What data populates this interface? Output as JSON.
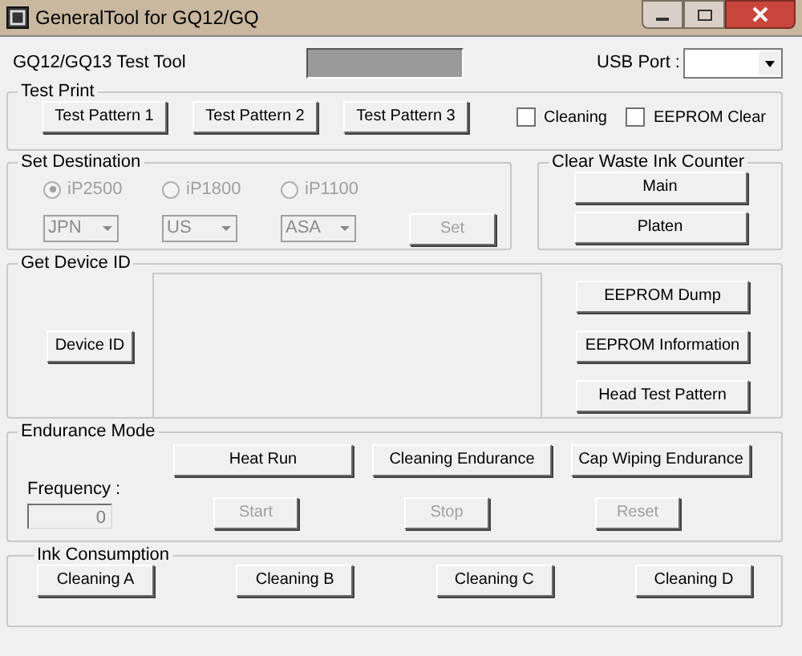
{
  "window": {
    "title": "GeneralTool for GQ12/GQ"
  },
  "header": {
    "title": "GQ12/GQ13 Test Tool",
    "usb_port": {
      "label": "USB Port :"
    }
  },
  "test_print": {
    "title": "Test Print",
    "buttons": [
      "Test Pattern 1",
      "Test Pattern 2",
      "Test Pattern 3"
    ],
    "checkboxes": [
      {
        "label": "Cleaning",
        "checked": false
      },
      {
        "label": "EEPROM Clear",
        "checked": false
      }
    ]
  },
  "set_destination": {
    "title": "Set Destination",
    "disabled": true,
    "models": [
      {
        "label": "iP2500",
        "selected": true
      },
      {
        "label": "iP1800",
        "selected": false
      },
      {
        "label": "iP1100",
        "selected": false
      }
    ],
    "regions": [
      "JPN",
      "US",
      "ASA"
    ],
    "set_button": "Set"
  },
  "clear_waste_ink_counter": {
    "title": "Clear Waste Ink Counter",
    "buttons": [
      "Main",
      "Platen"
    ]
  },
  "get_device_id": {
    "title": "Get Device ID",
    "device_id_button": "Device ID",
    "buttons": [
      "EEPROM Dump",
      "EEPROM Information",
      "Head Test Pattern"
    ]
  },
  "endurance_mode": {
    "title": "Endurance Mode",
    "buttons": [
      "Heat Run",
      "Cleaning Endurance",
      "Cap Wiping Endurance"
    ],
    "frequency": {
      "label": "Frequency :",
      "value": "0",
      "disabled": true
    },
    "controls": [
      {
        "label": "Start",
        "disabled": true
      },
      {
        "label": "Stop",
        "disabled": true
      },
      {
        "label": "Reset",
        "disabled": true
      }
    ]
  },
  "ink_consumption": {
    "title": "Ink Consumption",
    "buttons": [
      "Cleaning A",
      "Cleaning B",
      "Cleaning C",
      "Cleaning D"
    ]
  }
}
